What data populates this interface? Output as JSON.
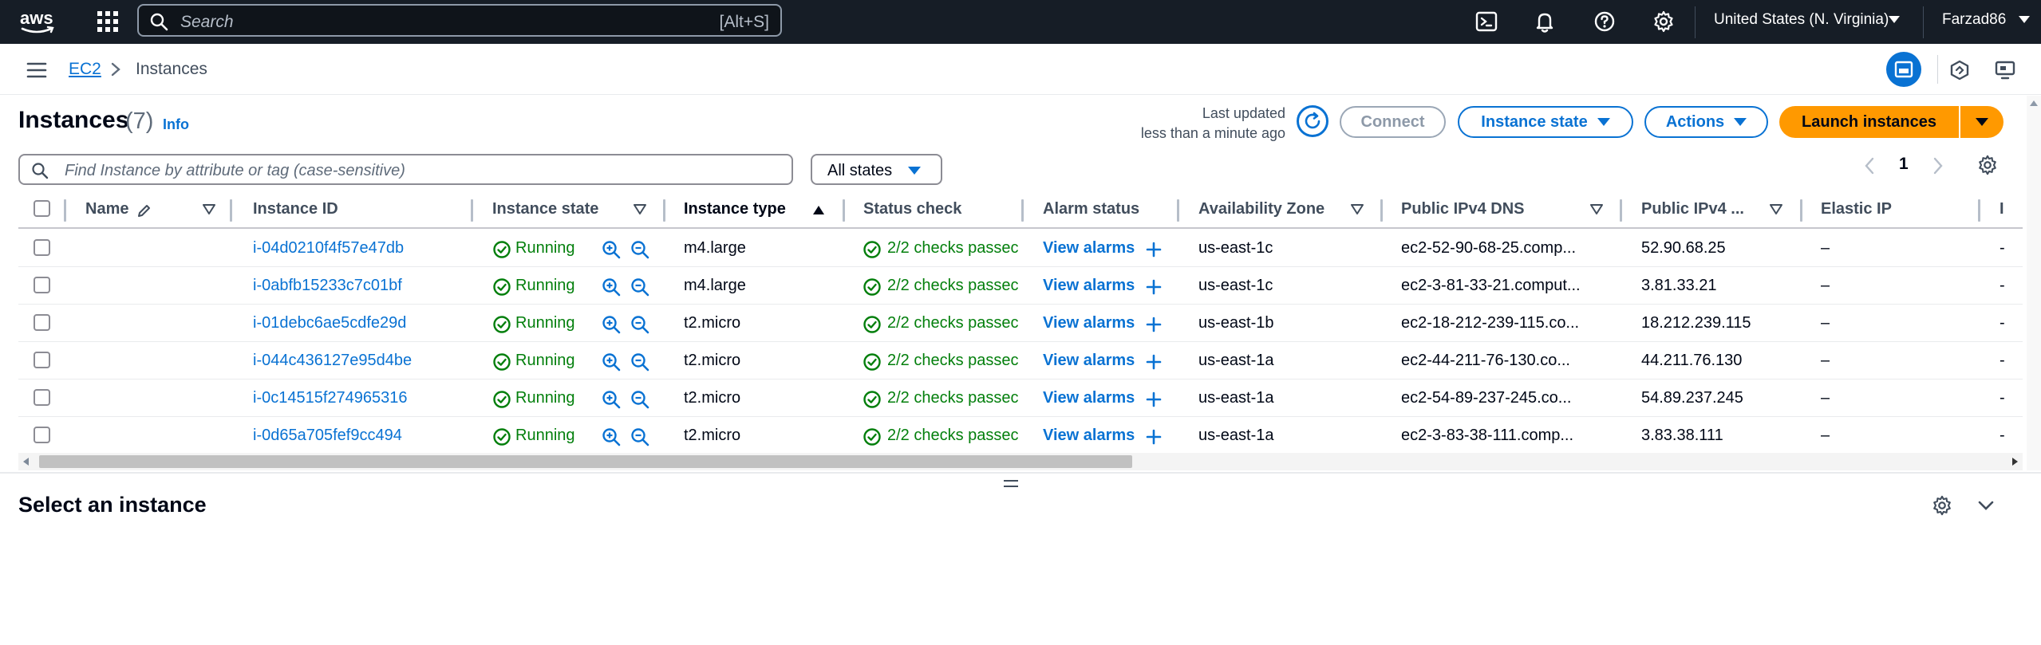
{
  "topnav": {
    "search_placeholder": "Search",
    "search_shortcut": "[Alt+S]",
    "region": "United States (N. Virginia)",
    "user": "Farzad86"
  },
  "breadcrumb": {
    "root": "EC2",
    "current": "Instances"
  },
  "header": {
    "title": "Instances",
    "count": "(7)",
    "info": "Info",
    "last_updated_label": "Last updated",
    "last_updated_value": "less than a minute ago",
    "connect": "Connect",
    "instance_state": "Instance state",
    "actions": "Actions",
    "launch": "Launch instances"
  },
  "filter": {
    "placeholder": "Find Instance by attribute or tag (case-sensitive)",
    "states": "All states",
    "page": "1"
  },
  "table": {
    "columns": {
      "name": "Name",
      "instance_id": "Instance ID",
      "instance_state": "Instance state",
      "instance_type": "Instance type",
      "status_check": "Status check",
      "alarm_status": "Alarm status",
      "az": "Availability Zone",
      "dns": "Public IPv4 DNS",
      "ip": "Public IPv4 ...",
      "eip": "Elastic IP",
      "extra": "I"
    },
    "rows": [
      {
        "id": "i-04d0210f4f57e47db",
        "state": "Running",
        "type": "m4.large",
        "status": "2/2 checks passec",
        "alarm": "View alarms",
        "az": "us-east-1c",
        "dns": "ec2-52-90-68-25.comp...",
        "ip": "52.90.68.25",
        "eip": "–",
        "extra": "-"
      },
      {
        "id": "i-0abfb15233c7c01bf",
        "state": "Running",
        "type": "m4.large",
        "status": "2/2 checks passec",
        "alarm": "View alarms",
        "az": "us-east-1c",
        "dns": "ec2-3-81-33-21.comput...",
        "ip": "3.81.33.21",
        "eip": "–",
        "extra": "-"
      },
      {
        "id": "i-01debc6ae5cdfe29d",
        "state": "Running",
        "type": "t2.micro",
        "status": "2/2 checks passec",
        "alarm": "View alarms",
        "az": "us-east-1b",
        "dns": "ec2-18-212-239-115.co...",
        "ip": "18.212.239.115",
        "eip": "–",
        "extra": "-"
      },
      {
        "id": "i-044c436127e95d4be",
        "state": "Running",
        "type": "t2.micro",
        "status": "2/2 checks passec",
        "alarm": "View alarms",
        "az": "us-east-1a",
        "dns": "ec2-44-211-76-130.co...",
        "ip": "44.211.76.130",
        "eip": "–",
        "extra": "-"
      },
      {
        "id": "i-0c14515f274965316",
        "state": "Running",
        "type": "t2.micro",
        "status": "2/2 checks passec",
        "alarm": "View alarms",
        "az": "us-east-1a",
        "dns": "ec2-54-89-237-245.co...",
        "ip": "54.89.237.245",
        "eip": "–",
        "extra": "-"
      },
      {
        "id": "i-0d65a705fef9cc494",
        "state": "Running",
        "type": "t2.micro",
        "status": "2/2 checks passec",
        "alarm": "View alarms",
        "az": "us-east-1a",
        "dns": "ec2-3-83-38-111.comp...",
        "ip": "3.83.38.111",
        "eip": "–",
        "extra": "-"
      }
    ]
  },
  "bottom": {
    "title": "Select an instance"
  },
  "colors": {
    "nav_bg": "#161d26",
    "link": "#0972d3",
    "success": "#037f0c",
    "launch": "#ff9900"
  },
  "icons": [
    "aws-logo",
    "apps-grid-icon",
    "search-icon",
    "cloudshell-icon",
    "bell-icon",
    "help-icon",
    "gear-icon",
    "hamburger-icon",
    "chevron-right-icon",
    "refresh-icon",
    "caret-down-icon",
    "pencil-icon",
    "sort-icon",
    "check-circle-icon",
    "zoom-in-icon",
    "zoom-out-icon",
    "plus-icon",
    "chevron-left-icon",
    "chevron-down-icon"
  ]
}
